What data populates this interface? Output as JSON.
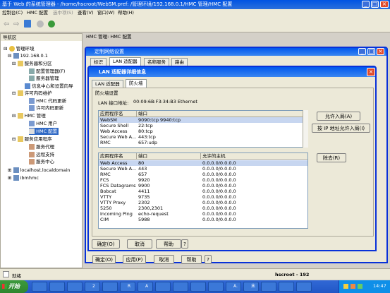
{
  "window": {
    "title": "基于 Web 的系统管理器 - /home/hscroot/WebSM.pref: /管理环境/192.168.0.1/HMC 管理/HMC 配置"
  },
  "menu": [
    "控制台(C)",
    "HMC 配置",
    "选中项(S)",
    "查看(V)",
    "窗口(W)",
    "帮助(H)"
  ],
  "nav": {
    "title": "导航区",
    "root": "管理环境",
    "host": "192.168.0.1",
    "items": [
      "服务器和分区",
      "配置管理器(F)",
      "服务器管理",
      "信息中心和设置向导",
      "许可内码维护",
      "HMC 代码更新",
      "许可内码更新",
      "HMC 管理",
      "HMC 用户",
      "HMC 配置",
      "服务应用程序",
      "服务代理",
      "远程支持",
      "服务中心",
      "localhost.localdomain",
      "ibmhmc"
    ]
  },
  "main": {
    "header": "HMC 管理: HMC 配置"
  },
  "network_dialog": {
    "title": "定制网络设置",
    "tabs": [
      "标识",
      "LAN 适配器",
      "名称服务",
      "路由"
    ],
    "buttons": [
      "确定(O)",
      "应用(P)",
      "取消",
      "帮助",
      "?"
    ]
  },
  "lan_dialog": {
    "title": "LAN 适配器详细信息",
    "tabs": [
      "LAN 适配器",
      "防火墙"
    ],
    "group_title": "防火墙设置",
    "lan_address_label": "LAN 接口地址:",
    "lan_address_value": "00:09:6B:F3:34:B3 Ethernet",
    "top_table": {
      "headers": [
        "应用程序名",
        "端口"
      ],
      "rows": [
        [
          "WebSM",
          "9090:tcp 9940:tcp"
        ],
        [
          "Secure Shell",
          "22:tcp"
        ],
        [
          "Web Access",
          "80:tcp"
        ],
        [
          "Secure Web A...",
          "443:tcp"
        ],
        [
          "RMC",
          "657:udp"
        ]
      ]
    },
    "allow_incoming_button": "允许入局(A)",
    "allow_by_ip_button": "按 IP 地址允许入局(I)",
    "bottom_table": {
      "headers": [
        "应用程序名",
        "端口",
        "允许的主机"
      ],
      "rows": [
        [
          "Web Access",
          "80",
          "0.0.0.0/0.0.0.0"
        ],
        [
          "Secure Web A...",
          "443",
          "0.0.0.0/0.0.0.0"
        ],
        [
          "RMC",
          "657",
          "0.0.0.0/0.0.0.0"
        ],
        [
          "FCS",
          "9920",
          "0.0.0.0/0.0.0.0"
        ],
        [
          "FCS Datagrams",
          "9900",
          "0.0.0.0/0.0.0.0"
        ],
        [
          "Bobcat",
          "4411",
          "0.0.0.0/0.0.0.0"
        ],
        [
          "VTTY",
          "9735",
          "0.0.0.0/0.0.0.0"
        ],
        [
          "VTTY Proxy",
          "2302",
          "0.0.0.0/0.0.0.0"
        ],
        [
          "5250",
          "2300,2301",
          "0.0.0.0/0.0.0.0"
        ],
        [
          "Incoming Ping",
          "echo-request",
          "0.0.0.0/0.0.0.0"
        ],
        [
          "CIM",
          "5988",
          "0.0.0.0/0.0.0.0"
        ]
      ]
    },
    "remove_button": "除去(R)",
    "buttons": [
      "确定(O)",
      "取消",
      "帮助",
      "?"
    ]
  },
  "status": {
    "text": "就绪",
    "user": "hscroot - 192"
  },
  "taskbar": {
    "start": "开始",
    "items": [
      "",
      "",
      "",
      "2",
      "",
      "R",
      "A",
      "",
      "",
      "",
      "",
      "A.",
      "末",
      "",
      "",
      ""
    ],
    "clock": "14:47"
  },
  "colors": {
    "title_blue": "#0a246a",
    "xp_blue": "#245edb",
    "selection": "#c7d6f0"
  }
}
